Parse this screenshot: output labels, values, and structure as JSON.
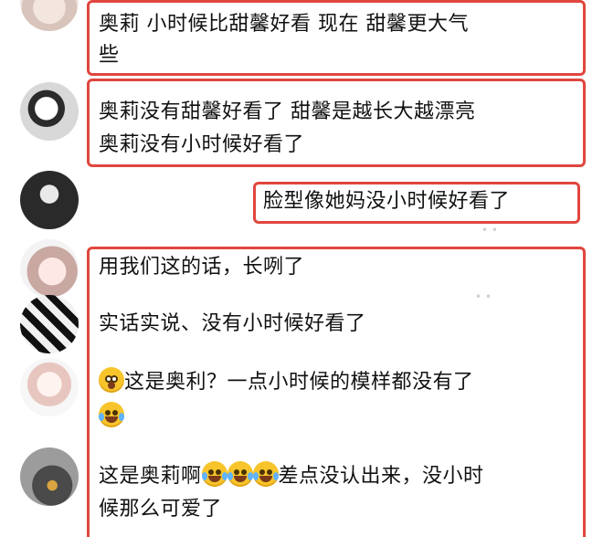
{
  "comments": [
    {
      "lines": [
        "奥莉  小时候比甜馨好看    现在  甜馨更大气",
        "些"
      ]
    },
    {
      "lines": [
        "奥莉没有甜馨好看了    甜馨是越长大越漂亮",
        "奥莉没有小时候好看了"
      ]
    },
    {
      "lines": [
        "脸型像她妈没小时候好看了"
      ]
    },
    {
      "lines": [
        "用我们这的话，长咧了"
      ]
    },
    {
      "lines": [
        "实话实说、没有小时候好看了"
      ]
    },
    {
      "lines": [
        "这是奥利？一点小时候的模样都没有了"
      ]
    },
    {
      "lines": [
        "这是奥莉啊",
        "差点没认出来，没小时",
        "候那么可爱了"
      ]
    }
  ],
  "emojis": {
    "shock": "shocked-face-icon",
    "laugh_cry": "laughing-crying-face-icon"
  },
  "accent_color": "#e0463e"
}
